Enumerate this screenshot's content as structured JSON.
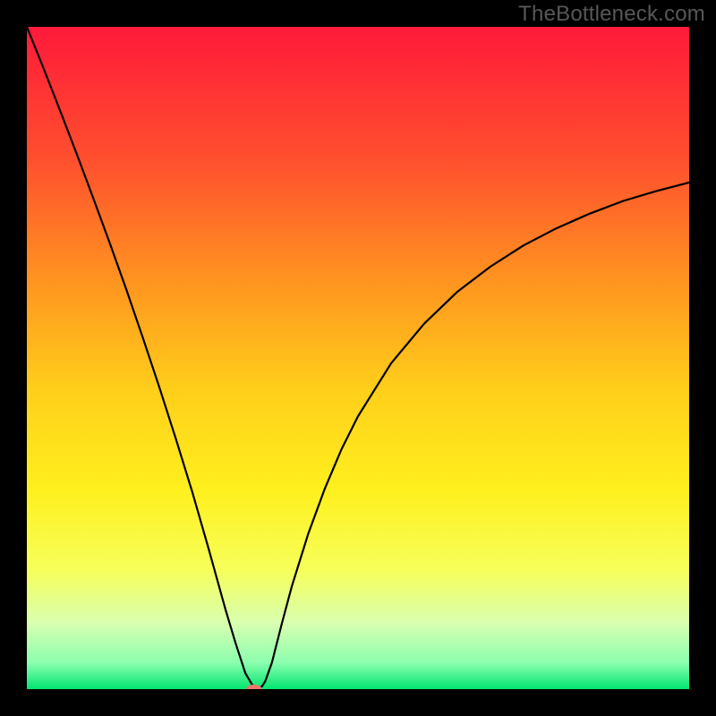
{
  "watermark": "TheBottleneck.com",
  "chart_data": {
    "type": "line",
    "title": "",
    "xlabel": "",
    "ylabel": "",
    "xlim": [
      0,
      100
    ],
    "ylim": [
      0,
      100
    ],
    "grid": false,
    "annotations": [],
    "gradient_stops": [
      {
        "offset": 0.0,
        "color": "#ff1a3a"
      },
      {
        "offset": 0.2,
        "color": "#ff4f2e"
      },
      {
        "offset": 0.4,
        "color": "#ff9a1f"
      },
      {
        "offset": 0.55,
        "color": "#ffcf1a"
      },
      {
        "offset": 0.7,
        "color": "#fff01e"
      },
      {
        "offset": 0.82,
        "color": "#f6ff5a"
      },
      {
        "offset": 0.9,
        "color": "#d9ffb0"
      },
      {
        "offset": 0.96,
        "color": "#8cffaf"
      },
      {
        "offset": 1.0,
        "color": "#00e56f"
      }
    ],
    "series": [
      {
        "name": "bottleneck-curve",
        "x": [
          0.0,
          2.5,
          5.0,
          7.5,
          10.0,
          12.5,
          15.0,
          17.5,
          20.0,
          22.5,
          25.0,
          27.5,
          30.0,
          31.5,
          33.0,
          34.0,
          34.8,
          35.5,
          36.0,
          37.0,
          38.5,
          40.0,
          42.5,
          45.0,
          47.5,
          50.0,
          55.0,
          60.0,
          65.0,
          70.0,
          75.0,
          80.0,
          85.0,
          90.0,
          95.0,
          100.0
        ],
        "y": [
          100.0,
          93.8,
          87.4,
          80.9,
          74.2,
          67.4,
          60.4,
          53.1,
          45.6,
          37.8,
          29.7,
          21.0,
          12.0,
          7.0,
          2.4,
          0.7,
          0.1,
          0.4,
          1.2,
          4.0,
          9.9,
          15.5,
          23.5,
          30.3,
          36.2,
          41.2,
          49.2,
          55.2,
          60.0,
          63.8,
          67.0,
          69.6,
          71.8,
          73.7,
          75.2,
          76.5
        ]
      }
    ],
    "marker": {
      "x": 34.3,
      "y": 0.0,
      "color": "#e8786b",
      "rx": 1.2,
      "ry": 0.7
    }
  }
}
